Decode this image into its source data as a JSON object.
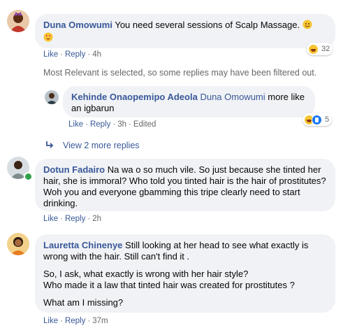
{
  "comments": [
    {
      "author": "Duna Omowumi",
      "text": "You need several sessions of Scalp Massage.",
      "actions": {
        "like": "Like",
        "reply": "Reply",
        "time": "4h"
      },
      "reaction_count": "32"
    },
    {
      "author": "Dotun Fadairo",
      "text": "Na wa o so much vile. So just because she tinted her hair, she is immoral? Who told you tinted hair is the hair of prostitutes? Woh you and everyone gbamming this tripe clearly need to start drinking.",
      "actions": {
        "like": "Like",
        "reply": "Reply",
        "time": "2h"
      }
    },
    {
      "author": "Lauretta Chinenye",
      "text_p1": "Still looking at her head to see what exactly is wrong with the hair. Still can't find it .",
      "text_p2a": "So, I ask, what exactly is wrong with her hair style?",
      "text_p2b": "Who made it a law that tinted hair was created for prostitutes ?",
      "text_p3": "What am I missing?",
      "actions": {
        "like": "Like",
        "reply": "Reply",
        "time": "37m"
      }
    }
  ],
  "filter_notice": "Most Relevant is selected, so some replies may have been filtered out.",
  "reply": {
    "author": "Kehinde Onaopemipo Adeola",
    "mention": "Duna Omowumi",
    "text": "more like an igbarun",
    "actions": {
      "like": "Like",
      "reply": "Reply",
      "time": "3h",
      "edited": "Edited"
    },
    "reaction_count": "5"
  },
  "view_more": "View 2 more replies",
  "icons": {
    "reply_arrow": "reply-arrow-icon"
  },
  "colors": {
    "link": "#385898",
    "bubble": "#f0f2f5",
    "meta": "#65676b",
    "online": "#31a24c"
  }
}
